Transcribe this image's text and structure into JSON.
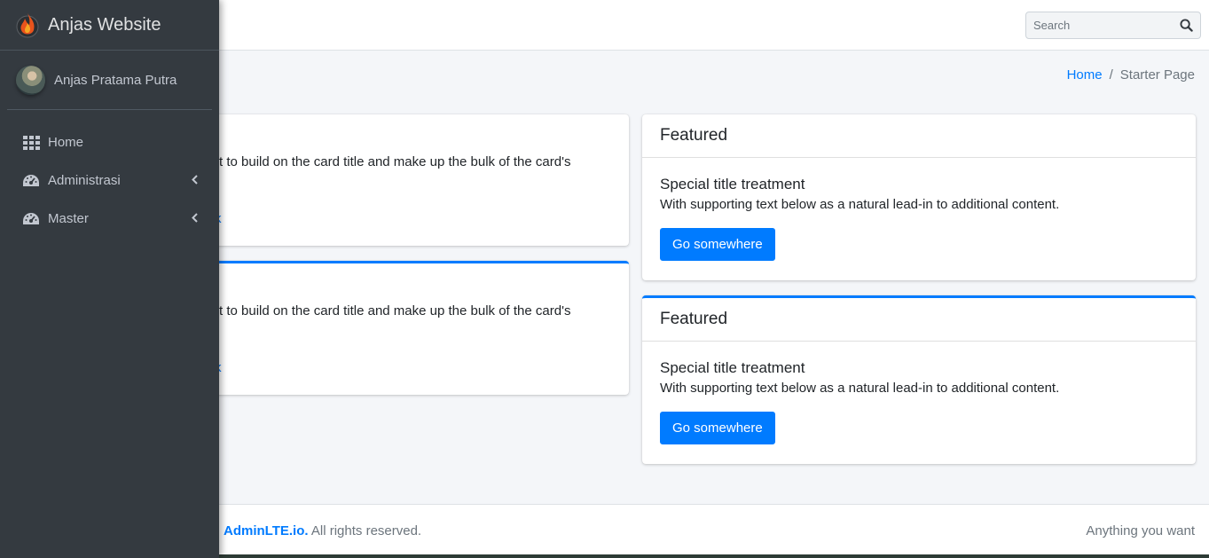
{
  "brand": {
    "name": "Anjas Website",
    "logo_icon": "flame-logo-icon"
  },
  "user": {
    "name": "Anjas Pratama Putra"
  },
  "sidebar": {
    "items": [
      {
        "label": "Home",
        "icon": "grid-icon"
      },
      {
        "label": "Administrasi",
        "icon": "tachometer-icon",
        "has_submenu": true
      },
      {
        "label": "Master",
        "icon": "tachometer-icon",
        "has_submenu": true
      }
    ]
  },
  "search": {
    "placeholder": "Search",
    "value": ""
  },
  "breadcrumb": {
    "home": "Home",
    "separator": "/",
    "current": "Starter Page"
  },
  "left_cards": [
    {
      "text": "text to build on the card title and make up the bulk of the card's",
      "link": "link"
    },
    {
      "text": "text to build on the card title and make up the bulk of the card's",
      "link": "link"
    }
  ],
  "right_cards": [
    {
      "header": "Featured",
      "title": "Special title treatment",
      "text": "With supporting text below as a natural lead-in to additional content.",
      "button": "Go somewhere"
    },
    {
      "header": "Featured",
      "title": "Special title treatment",
      "text": "With supporting text below as a natural lead-in to additional content.",
      "button": "Go somewhere"
    }
  ],
  "footer": {
    "brand_link": "AdminLTE.io.",
    "rights": " All rights reserved.",
    "right_text": "Anything you want"
  },
  "colors": {
    "accent": "#007bff",
    "sidebar_bg": "#343a40",
    "content_bg": "#f4f6f9"
  }
}
